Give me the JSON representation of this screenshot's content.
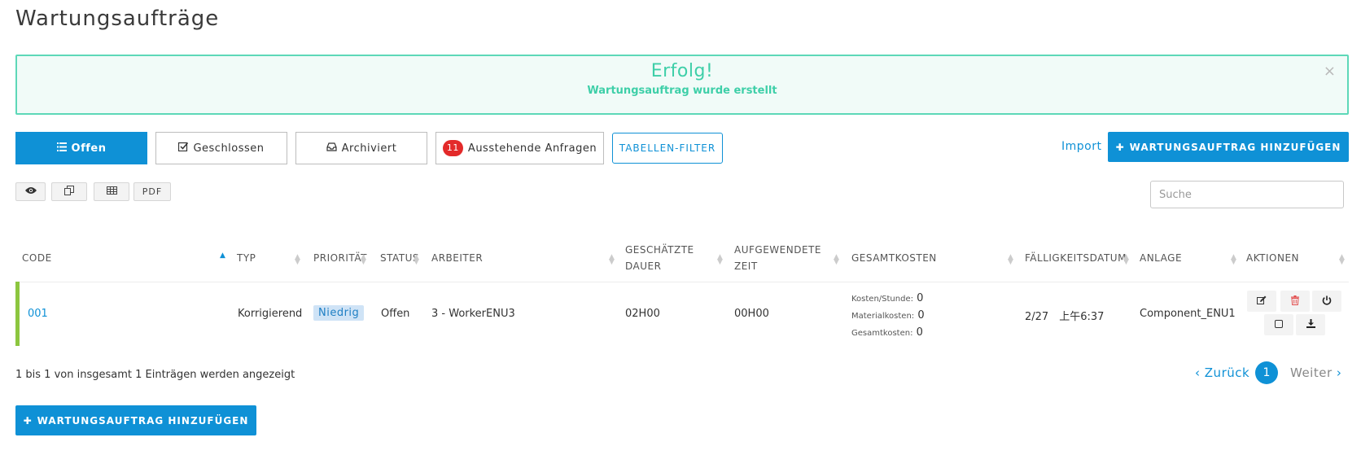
{
  "page": {
    "title": "Wartungsaufträge"
  },
  "alert": {
    "title": "Erfolg!",
    "message": "Wartungsauftrag wurde erstellt",
    "close": "×"
  },
  "tabs": [
    {
      "label": "Offen",
      "icon": "list-icon"
    },
    {
      "label": "Geschlossen",
      "icon": "check-square-icon"
    },
    {
      "label": "Archiviert",
      "icon": "inbox-icon"
    },
    {
      "label": "Ausstehende Anfragen",
      "badge": "11"
    }
  ],
  "filter_label": "TABELLEN-FILTER",
  "import_label": "Import",
  "add_label": "WARTUNGSAUFTRAG HINZUFÜGEN",
  "tools": {
    "pdf_label": "PDF"
  },
  "search": {
    "placeholder": "Suche"
  },
  "table": {
    "headers": {
      "code": "CODE",
      "type": "TYP",
      "priority": "PRIORITÄT",
      "status": "STATUS",
      "worker": "ARBEITER",
      "est_duration_1": "GESCHÄTZTE",
      "est_duration_2": "DAUER",
      "spent_time_1": "AUFGEWENDETE",
      "spent_time_2": "ZEIT",
      "total_cost": "GESAMTKOSTEN",
      "due_date": "FÄLLIGKEITSDATUM",
      "asset": "ANLAGE",
      "actions": "AKTIONEN"
    },
    "rows": [
      {
        "code": "001",
        "type": "Korrigierend",
        "priority": "Niedrig",
        "status": "Offen",
        "worker": "3 - WorkerENU3",
        "est_duration": "02H00",
        "spent_time": "00H00",
        "costs": [
          {
            "label": "Kosten/Stunde:",
            "value": "0"
          },
          {
            "label": "Materialkosten:",
            "value": "0"
          },
          {
            "label": "Gesamtkosten:",
            "value": "0"
          }
        ],
        "due_date": "2/27　上午6:37",
        "asset": "Component_ENU1",
        "status_color": "#8cc63f"
      }
    ]
  },
  "footer": {
    "info": "1 bis 1 von insgesamt 1 Einträgen werden angezeigt"
  },
  "pagination": {
    "prev": "Zurück",
    "page": "1",
    "next": "Weiter"
  },
  "colors": {
    "primary": "#0f91d6",
    "success": "#3ecfa8",
    "badge": "#e32a2a"
  }
}
